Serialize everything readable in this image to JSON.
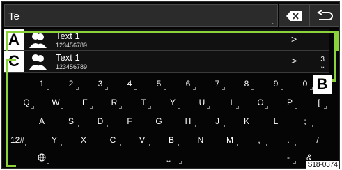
{
  "input": {
    "value": "Te",
    "chevron": "⌄"
  },
  "buttons": {
    "delete_icon": "backspace-icon",
    "back_icon": "return-icon"
  },
  "results": [
    {
      "badge": "A",
      "name": "Text 1",
      "number": "123456789",
      "arrow": ">"
    },
    {
      "badge": "C",
      "name": "Text 1",
      "number": "123456789",
      "arrow": ">"
    }
  ],
  "scroll": {
    "page": "3",
    "chevron": "⌄"
  },
  "keyboard": {
    "row1": [
      "1",
      "2",
      "3",
      "4",
      "5",
      "6",
      "7",
      "8",
      "9",
      "0"
    ],
    "row2": [
      "Q",
      "W",
      "E",
      "R",
      "T",
      "Y",
      "U",
      "I",
      "O",
      "P",
      "["
    ],
    "row3": [
      "A",
      "S",
      "D",
      "F",
      "G",
      "H",
      "J",
      "K",
      "L",
      ";"
    ],
    "row4": [
      "12#",
      "Y",
      "X",
      "C",
      "V",
      "B",
      "N",
      "M",
      ",",
      ".",
      "/"
    ],
    "row5": {
      "globe": "globe-icon",
      "space": "⎵",
      "dash": "-",
      "amp": "&"
    }
  },
  "badge_b": "B",
  "figure_code": "S18-0374",
  "accent_color": "#8cd23c"
}
